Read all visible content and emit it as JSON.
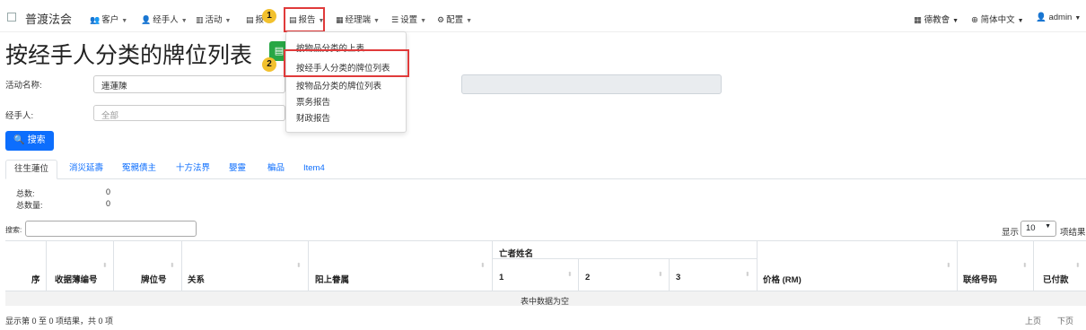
{
  "brand": {
    "name": "普渡法会"
  },
  "nav": {
    "customers": "客户",
    "agents": "经手人",
    "activities": "活动",
    "report_partial": "报",
    "reports": "报告",
    "manager": "经理端",
    "settings": "设置",
    "config": "配置"
  },
  "nav_right": {
    "temple": "德教會",
    "language": "简体中文",
    "user": "admin"
  },
  "markers": {
    "step1": "1",
    "step2": "2"
  },
  "dropdown": {
    "items": [
      "按物品分类的上表",
      "按经手人分类的牌位列表",
      "按物品分类的牌位列表",
      "票务报告",
      "财政报告"
    ]
  },
  "page": {
    "title": "按经手人分类的牌位列表"
  },
  "form": {
    "activity_label": "活动名称:",
    "activity_value": "連蓮陳",
    "agent_label": "经手人:",
    "agent_value": "全部",
    "search_button": "搜索"
  },
  "tabs": [
    "往生蓮位",
    "消災延壽",
    "冤親債主",
    "十方法界",
    "嬰靈",
    "楄品",
    "Item4"
  ],
  "stats": {
    "total_label": "总数:",
    "total_value": "0",
    "qty_label": "总数量:",
    "qty_value": "0"
  },
  "table": {
    "search_label": "搜索:",
    "length_prefix": "显示",
    "length_value": "10",
    "length_suffix": "项结果",
    "group_header": "亡者姓名",
    "columns": [
      "序",
      "收据薄编号",
      "牌位号",
      "关系",
      "阳上眷属",
      "1",
      "2",
      "3",
      "价格 (RM)",
      "联络号码",
      "已付款"
    ],
    "empty_message": "表中数据为空",
    "info": "显示第 0 至 0 项结果，共 0 项",
    "prev": "上页",
    "next": "下页"
  },
  "colors": {
    "primary": "#0d6efd",
    "highlight": "#e03a3a",
    "marker": "#f2c12e",
    "green": "#28a745"
  },
  "icons": [
    "people-icon",
    "person-icon",
    "book-icon",
    "report-icon",
    "manager-icon",
    "settings-icon",
    "gear-icon",
    "calendar-icon",
    "globe-icon",
    "search-icon",
    "file-icon"
  ]
}
